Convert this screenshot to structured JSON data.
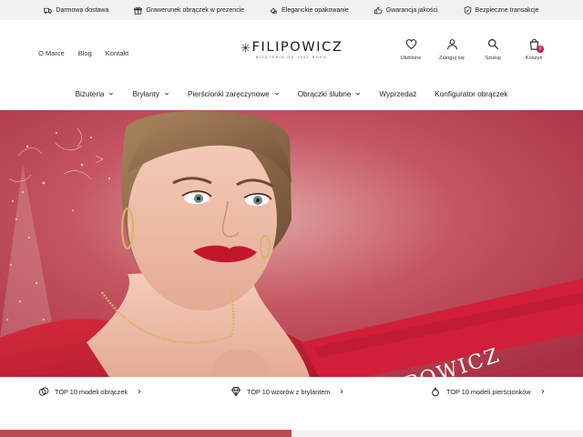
{
  "topbar": {
    "items": [
      {
        "label": "Darmowa dostawa",
        "icon": "truck-icon"
      },
      {
        "label": "Grawerunek obrączek w prezencie",
        "icon": "gift-icon"
      },
      {
        "label": "Eleganckie opakowanie",
        "icon": "package-icon"
      },
      {
        "label": "Gwarancja jakości",
        "icon": "thumbs-up-icon"
      },
      {
        "label": "Bezpieczne transakcje",
        "icon": "shield-icon"
      }
    ]
  },
  "header": {
    "links": [
      "O Marce",
      "Blog",
      "Kontakt"
    ],
    "logo": {
      "word": "FILIPOWICZ",
      "tagline": "BIŻUTERIA OD 1961 ROKU"
    },
    "icons": [
      {
        "label": "Ulubione",
        "icon": "heart-icon"
      },
      {
        "label": "Zaloguj się",
        "icon": "user-icon"
      },
      {
        "label": "Szukaj",
        "icon": "search-icon"
      },
      {
        "label": "Koszyk",
        "icon": "shopping-bag-icon",
        "badge": "0"
      }
    ]
  },
  "nav": {
    "items": [
      {
        "label": "Biżuteria",
        "dropdown": true
      },
      {
        "label": "Brylanty",
        "dropdown": true
      },
      {
        "label": "Pierścionki zaręczynowe",
        "dropdown": true
      },
      {
        "label": "Obrączki ślubne",
        "dropdown": true
      },
      {
        "label": "Wyprzedaż",
        "dropdown": false
      },
      {
        "label": "Konfigurator obrączek",
        "dropdown": false
      }
    ]
  },
  "hero": {
    "ribbon_text": "FILIPOWICZ",
    "background_color": "#b94353",
    "accent_color": "#c2185b"
  },
  "shortcuts": [
    {
      "label": "TOP 10 modeli obrączek",
      "icon": "rings-icon"
    },
    {
      "label": "TOP 10 wzorów z brylantem",
      "icon": "diamond-icon"
    },
    {
      "label": "TOP 10 modeli pierścionków",
      "icon": "ring-icon"
    }
  ]
}
